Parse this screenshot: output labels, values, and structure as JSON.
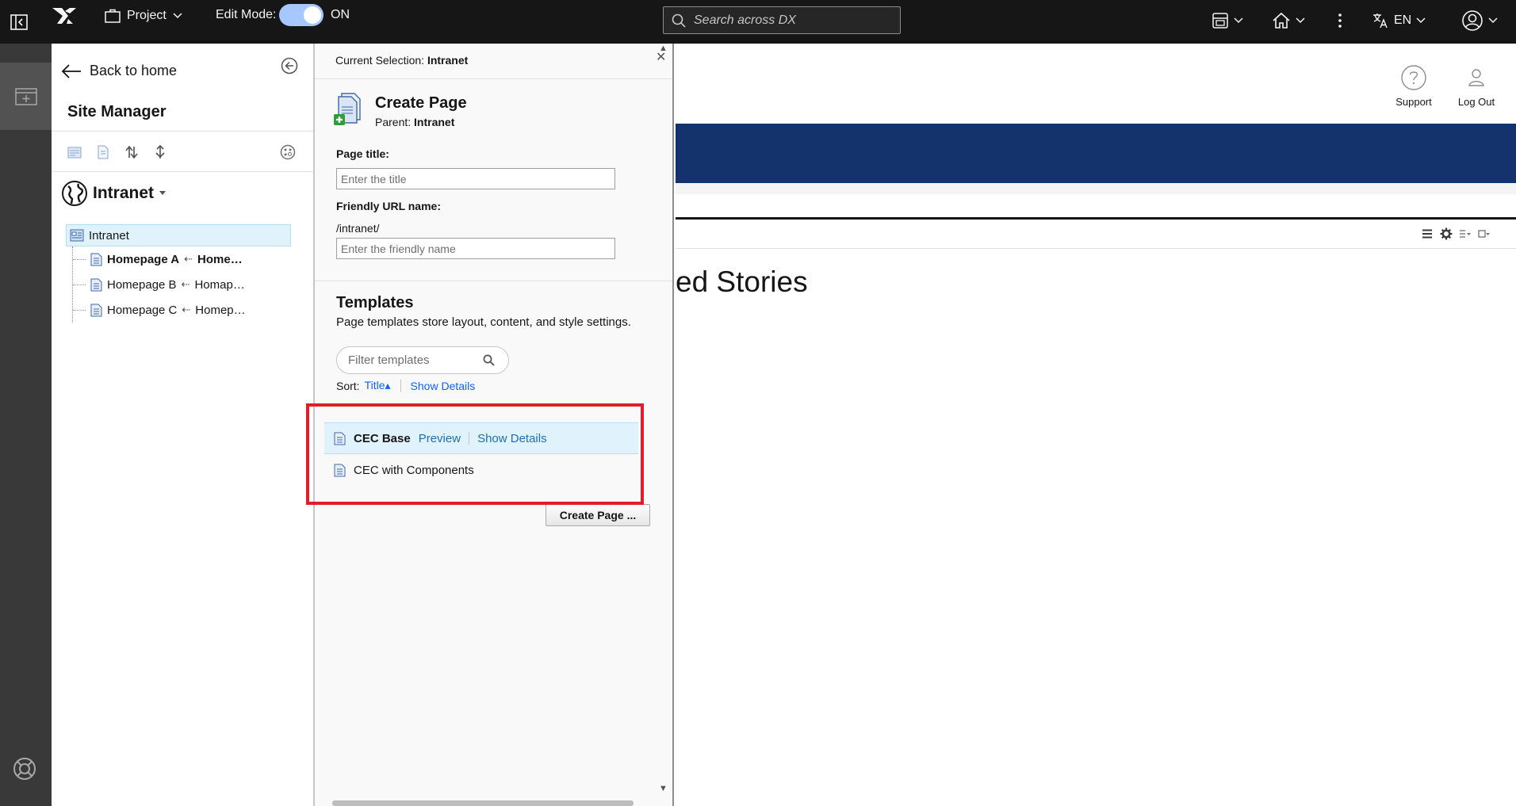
{
  "topbar": {
    "project_label": "Project",
    "edit_mode_label": "Edit Mode:",
    "edit_mode_state": "ON",
    "edit_mode_on": true,
    "search_placeholder": "Search across DX",
    "language": "EN",
    "icons": [
      "sidebar-toggle-icon",
      "dx-logo-icon",
      "briefcase-icon",
      "search-icon",
      "content-switcher-icon",
      "home-icon",
      "overflow-menu-icon",
      "translate-icon",
      "user-avatar-icon"
    ]
  },
  "rail": {
    "icons": [
      "add-page-icon",
      "help-lifesaver-icon"
    ]
  },
  "site_manager": {
    "back_label": "Back to home",
    "title": "Site Manager",
    "site_name": "Intranet",
    "tree": {
      "root": "Intranet",
      "children": [
        {
          "title": "Homepage A",
          "alias": "Home…",
          "bold": true
        },
        {
          "title": "Homepage B",
          "alias": "Homap…",
          "bold": false
        },
        {
          "title": "Homepage C",
          "alias": "Homep…",
          "bold": false
        }
      ]
    }
  },
  "create_page": {
    "selection_label": "Current Selection:",
    "selection_value": "Intranet",
    "heading": "Create Page",
    "parent_label": "Parent:",
    "parent_value": "Intranet",
    "page_title_label": "Page title:",
    "page_title_placeholder": "Enter the title",
    "friendly_url_label": "Friendly URL name:",
    "url_prefix": "/intranet/",
    "friendly_url_placeholder": "Enter the friendly name",
    "templates_title": "Templates",
    "templates_desc": "Page templates store layout, content, and style settings.",
    "filter_placeholder": "Filter templates",
    "sort_label": "Sort:",
    "sort_value": "Title",
    "show_details": "Show Details",
    "templates": [
      {
        "name": "CEC Base",
        "selected": true,
        "preview": "Preview",
        "details": "Show Details"
      },
      {
        "name": "CEC with Components",
        "selected": false
      }
    ],
    "create_button": "Create Page ..."
  },
  "content": {
    "support_label": "Support",
    "logout_label": "Log Out",
    "stories_title": "ed Stories",
    "banner_color": "#14326b"
  },
  "colors": {
    "topbar": "#161616",
    "rail": "#393939",
    "highlight": "#e01e2a",
    "link": "#1f6fb2"
  }
}
